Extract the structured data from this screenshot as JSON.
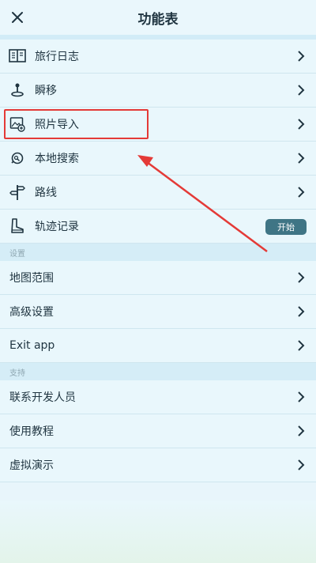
{
  "header": {
    "title": "功能表",
    "close_icon": "close-icon"
  },
  "menu": [
    {
      "label": "旅行日志",
      "icon": "journal-icon"
    },
    {
      "label": "瞬移",
      "icon": "joystick-icon"
    },
    {
      "label": "照片导入",
      "icon": "photo-import-icon"
    },
    {
      "label": "本地搜索",
      "icon": "local-search-icon"
    },
    {
      "label": "路线",
      "icon": "signpost-icon"
    },
    {
      "label": "轨迹记录",
      "icon": "boot-icon",
      "button": "开始"
    }
  ],
  "settings": {
    "header": "设置",
    "items": [
      {
        "label": "地图范围"
      },
      {
        "label": "高级设置"
      },
      {
        "label": "Exit app"
      }
    ]
  },
  "support": {
    "header": "支持",
    "items": [
      {
        "label": "联系开发人员"
      },
      {
        "label": "使用教程"
      },
      {
        "label": "虚拟演示"
      }
    ]
  },
  "colors": {
    "accent": "#3f7585",
    "highlight": "#e43a37",
    "background": "#e8f5fb"
  }
}
